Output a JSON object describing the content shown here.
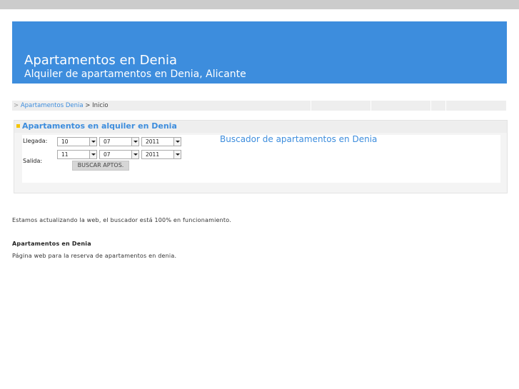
{
  "header": {
    "title": "Apartamentos en Denia",
    "subtitle": "Alquiler de apartamentos en Denia, Alicante"
  },
  "breadcrumb": {
    "separator": ">",
    "link": "Apartamentos Denia",
    "current": "> Inicio"
  },
  "search": {
    "heading": "Apartamentos en alquiler en Denia",
    "panel_title": "Buscador de apartamentos en Denia",
    "arrival_label": "Llegada:",
    "departure_label": "Salida:",
    "arrival": {
      "day": "10",
      "month": "07",
      "year": "2011"
    },
    "departure": {
      "day": "11",
      "month": "07",
      "year": "2011"
    },
    "button_label": "BUSCAR APTOS."
  },
  "content": {
    "notice": "Estamos actualizando la web, el buscador está 100% en funcionamiento.",
    "section_title": "Apartamentos en Denia",
    "description": "Página web para la reserva de apartamentos en denia."
  },
  "colors": {
    "brand_blue": "#3d8ddd",
    "top_bar": "#cccccc",
    "accent_bullet": "#f5c400"
  }
}
